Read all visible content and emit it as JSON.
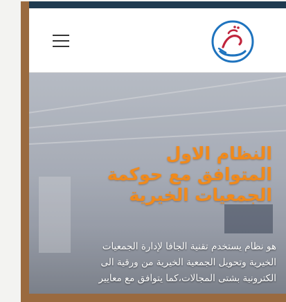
{
  "header": {
    "logo_icon": "charity-hands-logo-icon",
    "menu_icon": "hamburger-menu-icon"
  },
  "hero": {
    "title_lines": [
      "النظام الاول",
      "المتوافق مع حوكمة",
      "الجمعيات الخيرية"
    ],
    "description_lines": [
      "هو نظام يستخدم تقنية الجافا لإدارة الجمعيات",
      "الخيرية وتحويل الجمعية الخيرية من ورقية الى",
      "الكترونية بشتى المجالات،كما يتوافق مع معايير"
    ]
  },
  "colors": {
    "topbar": "#1e3a4f",
    "title": "#f08a1c",
    "logo_blue": "#1e73be",
    "logo_red": "#c0243c",
    "frame": "#9a6a3f"
  }
}
